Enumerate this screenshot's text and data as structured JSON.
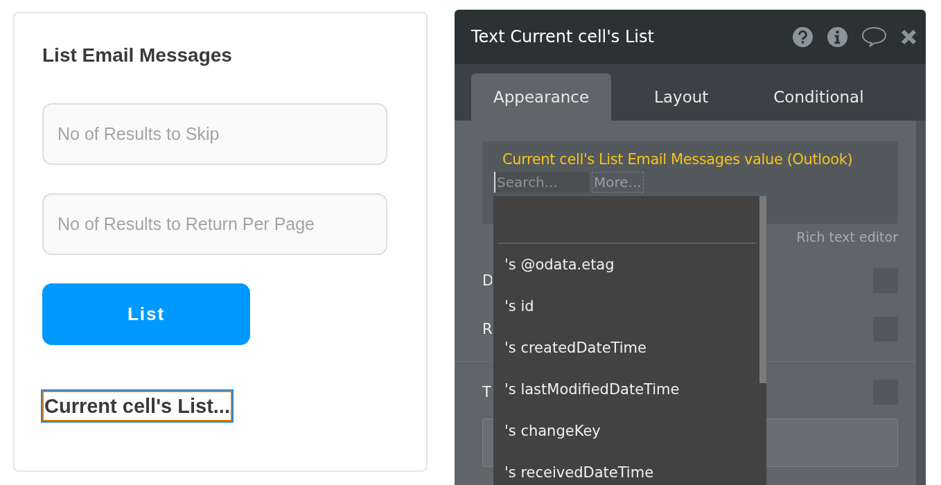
{
  "card": {
    "title": "List Email Messages",
    "fields": [
      {
        "placeholder": "No of Results to Skip"
      },
      {
        "placeholder": "No of Results to Return Per Page"
      }
    ],
    "button": "List",
    "selected_text": "Current cell's List..."
  },
  "panel": {
    "title": "Text Current cell's List",
    "tabs": [
      {
        "label": "Appearance",
        "selected": true
      },
      {
        "label": "Layout",
        "selected": false
      },
      {
        "label": "Conditional",
        "selected": false
      }
    ],
    "expression": "Current cell's List Email Messages value (Outlook)",
    "search": {
      "placeholder": "Search..."
    },
    "more": "More...",
    "rich_text_link": "Rich text editor",
    "rows": [
      {
        "label": "D",
        "checked": false
      },
      {
        "label": "R",
        "checked": false
      },
      {
        "label": "T",
        "checked": false
      }
    ],
    "dropdown": {
      "items": [
        "'s @odata.etag",
        "'s id",
        "'s createdDateTime",
        "'s lastModifiedDateTime",
        "'s changeKey",
        "'s receivedDateTime"
      ]
    }
  }
}
